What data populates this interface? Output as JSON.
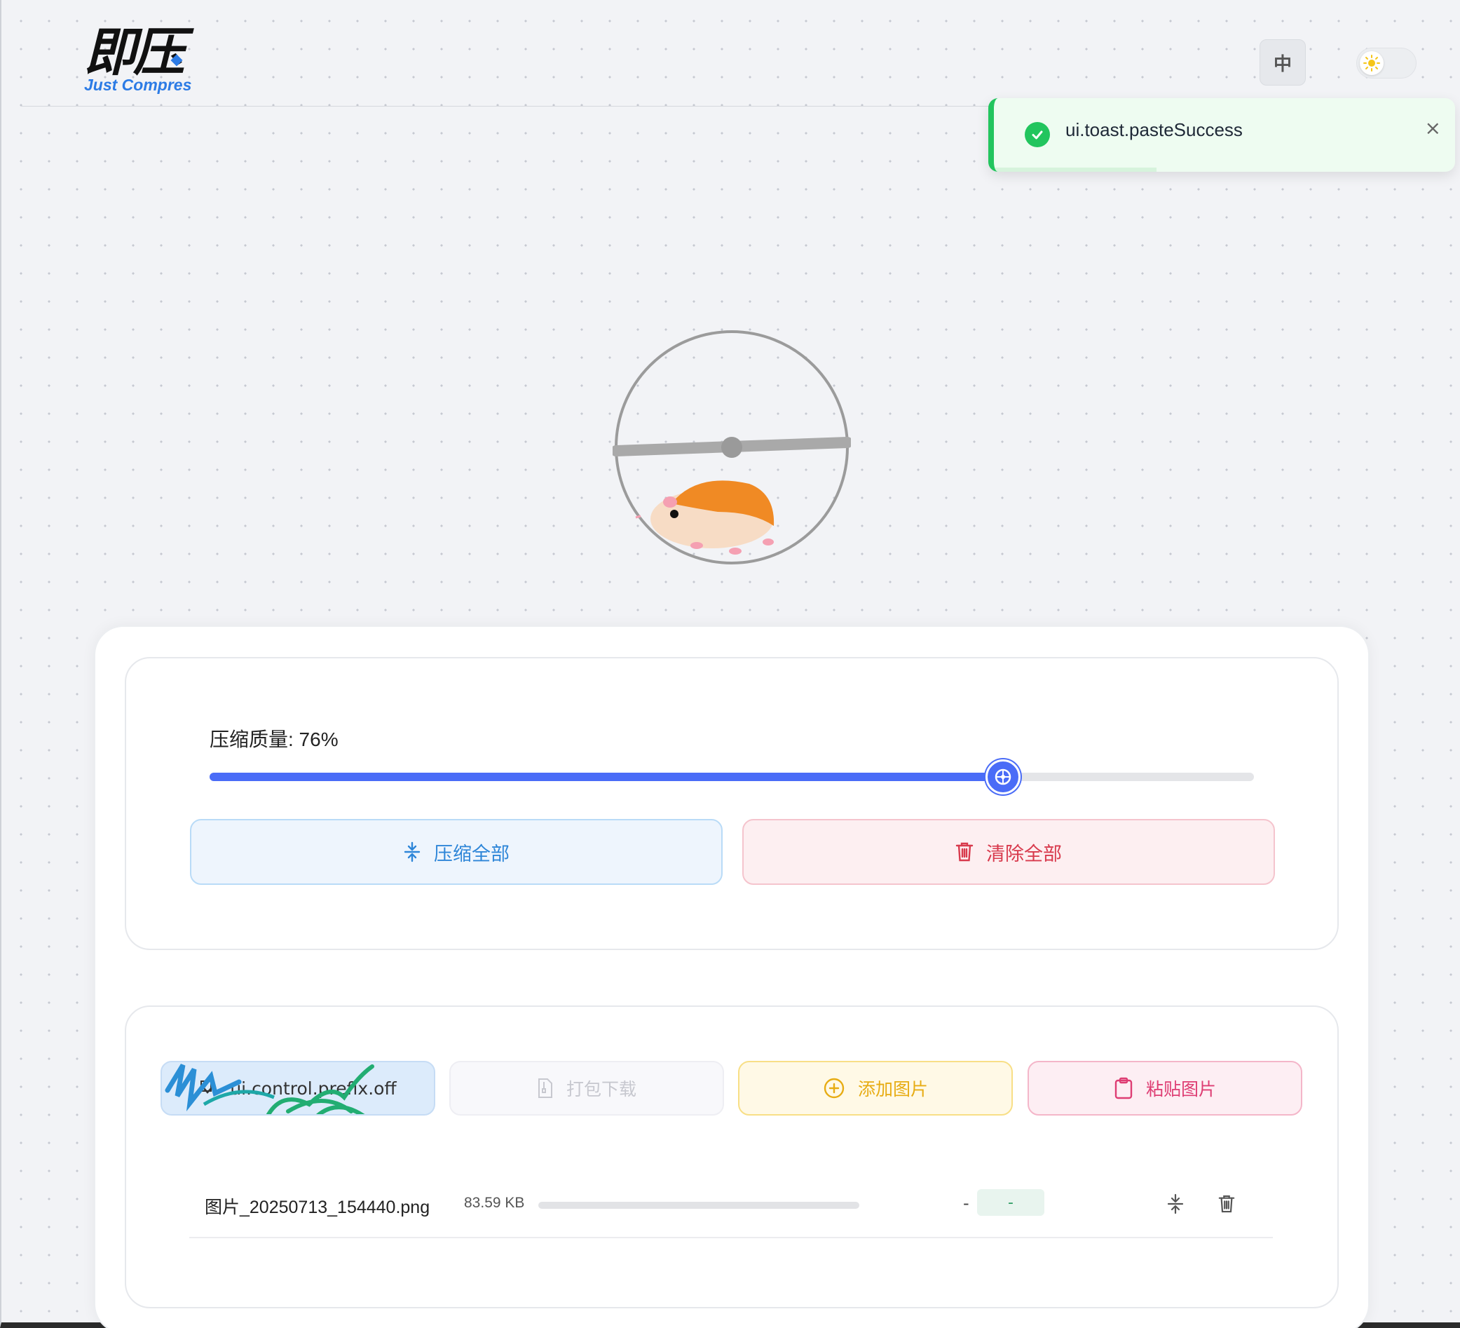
{
  "header": {
    "logo_text": "即压",
    "logo_sub": "Just Compres",
    "lang_button": "中",
    "theme_icon": "sun-icon"
  },
  "toast": {
    "message": "ui.toast.pasteSuccess",
    "close": "×",
    "icon": "check-circle-icon",
    "color": "#22c55e"
  },
  "illustration": {
    "name": "hamster-wheel"
  },
  "compression": {
    "quality_label": "压缩质量: 76%",
    "quality_value": 76,
    "compress_all": "压缩全部",
    "clear_all": "清除全部",
    "accent": "#4a6cf7"
  },
  "toolbar": {
    "prefix_toggle": "ui.control.prefix.off",
    "download_zip": "打包下载",
    "add_images": "添加图片",
    "paste_image": "粘贴图片"
  },
  "files": [
    {
      "name": "图片_20250713_154440.png",
      "size": "83.59 KB",
      "progress": 0,
      "result_dash": "-",
      "result_badge": "-"
    }
  ]
}
